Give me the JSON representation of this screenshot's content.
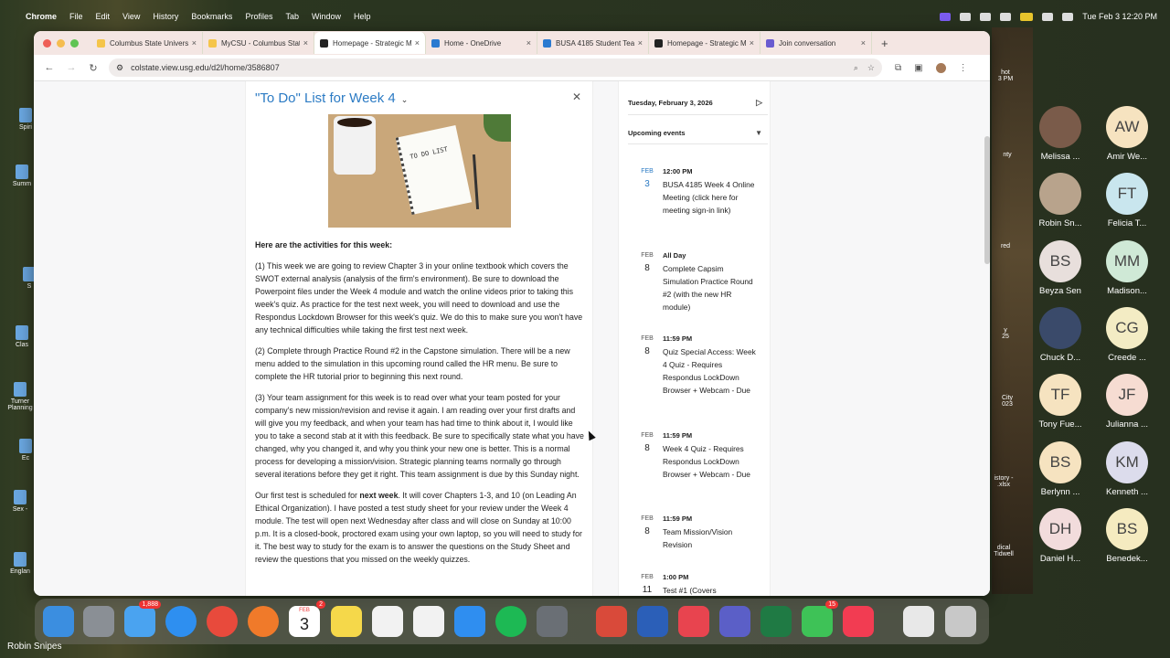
{
  "menubar": {
    "apple": "",
    "app": "Chrome",
    "items": [
      "File",
      "Edit",
      "View",
      "History",
      "Bookmarks",
      "Profiles",
      "Tab",
      "Window",
      "Help"
    ],
    "clock": "Tue Feb 3  12:20 PM"
  },
  "desktop": {
    "left_labels": [
      "Spiri",
      "Summ",
      "S",
      "Clas",
      "Turner\nPlanning",
      "Ec",
      "Sex -",
      "Englan"
    ],
    "right_labels": [
      "hot\n3 PM",
      "nty",
      "red",
      "y\n25",
      "City\n023",
      "istory -\n.xlsx",
      "dical\nTidwell"
    ]
  },
  "browser": {
    "tabs": [
      {
        "label": "Columbus State Universit",
        "color": "#f5c54a"
      },
      {
        "label": "MyCSU - Columbus State",
        "color": "#f5c54a"
      },
      {
        "label": "Homepage - Strategic M",
        "color": "#222"
      },
      {
        "label": "Home - OneDrive",
        "color": "#2b7ad0"
      },
      {
        "label": "BUSA 4185 Student Team",
        "color": "#2b7ad0"
      },
      {
        "label": "Homepage - Strategic M",
        "color": "#222"
      },
      {
        "label": "Join conversation",
        "color": "#6a5bd0"
      }
    ],
    "new_tab": "+",
    "url": "colstate.view.usg.edu/d2l/home/3586807"
  },
  "todo": {
    "title": "\"To Do\" List for Week 4",
    "photo_text": "TO DO LIST",
    "heading": "Here are the activities for this week:",
    "p1": "(1) This week we are going to review Chapter 3 in your online textbook which covers the SWOT external analysis (analysis of the firm's environment).  Be sure to download the Powerpoint files under the Week 4 module and watch the online videos prior to taking this week's quiz. As practice for the test next week, you will need to download and use the Respondus Lockdown Browser for this week's quiz. We do this to make sure you won't have any technical difficulties while taking the first test next week.",
    "p2": "(2) Complete through Practice Round #2 in the Capstone simulation. There will be a new menu added to the simulation in this upcoming round called the HR menu. Be sure to complete the HR tutorial prior to beginning this next round.",
    "p3": "(3) Your team assignment for this week is to read over what your team posted for your company's new mission/revision and revise it again. I am reading over your first drafts and will give you my feedback, and when your team has had time to think about it, I would like you to take a second stab at it with this feedback. Be sure to specifically state what you have changed, why you changed it, and why you think your new one is better. This is a normal process for developing a mission/vision. Strategic planning teams normally go through several iterations before they get it right. This team assignment is due by this Sunday night.",
    "p4_a": "Our first test is scheduled for ",
    "p4_b": "next week",
    "p4_c": ". It will cover Chapters 1-3, and 10 (on Leading An Ethical Organization).  I have posted a test study sheet for your review under the Week 4 module. The test will open next Wednesday after class and will close on Sunday at 10:00 p.m. It is a closed-book, proctored exam using your own laptop, so you will need to study for it. The best way to study for the exam is to answer the questions on the Study Sheet and review the questions that you missed on the weekly quizzes."
  },
  "calendar": {
    "date": "Tuesday, February 3, 2026",
    "upcoming": "Upcoming events",
    "events": [
      {
        "mon": "FEB",
        "day": "3",
        "time": "12:00 PM",
        "title": "BUSA 4185 Week 4 Online Meeting (click here for meeting sign-in link)"
      },
      {
        "mon": "FEB",
        "day": "8",
        "time": "All Day",
        "title": "Complete Capsim Simulation Practice Round #2 (with the new HR module)"
      },
      {
        "mon": "FEB",
        "day": "8",
        "time": "11:59 PM",
        "title": "Quiz Special Access: Week 4 Quiz - Requires Respondus LockDown Browser + Webcam - Due"
      },
      {
        "mon": "FEB",
        "day": "8",
        "time": "11:59 PM",
        "title": "Week 4 Quiz - Requires Respondus LockDown Browser + Webcam - Due"
      },
      {
        "mon": "FEB",
        "day": "8",
        "time": "11:59 PM",
        "title": "Team Mission/Vision Revision"
      },
      {
        "mon": "FEB",
        "day": "11",
        "time": "1:00 PM",
        "title": "Test #1 (Covers"
      }
    ]
  },
  "participants": [
    {
      "name": "Melissa ...",
      "initials": "",
      "bg": "#7a5b4a"
    },
    {
      "name": "Amir We...",
      "initials": "AW",
      "bg": "#f6e3c0"
    },
    {
      "name": "Robin Sn...",
      "initials": "",
      "bg": "#b8a38c"
    },
    {
      "name": "Felicia T...",
      "initials": "FT",
      "bg": "#c9e6ee"
    },
    {
      "name": "Beyza Sen",
      "initials": "BS",
      "bg": "#e8dfdc"
    },
    {
      "name": "Madison...",
      "initials": "MM",
      "bg": "#cfe9d6"
    },
    {
      "name": "Chuck D...",
      "initials": "",
      "bg": "#3a4a6a"
    },
    {
      "name": "Creede ...",
      "initials": "CG",
      "bg": "#f3ecc4"
    },
    {
      "name": "Tony Fue...",
      "initials": "TF",
      "bg": "#f6e3c0"
    },
    {
      "name": "Julianna ...",
      "initials": "JF",
      "bg": "#f6dcd2"
    },
    {
      "name": "Berlynn ...",
      "initials": "BS",
      "bg": "#f6e3c0"
    },
    {
      "name": "Kenneth ...",
      "initials": "KM",
      "bg": "#dcdcec"
    },
    {
      "name": "Daniel H...",
      "initials": "DH",
      "bg": "#f2dcdc"
    },
    {
      "name": "Benedek...",
      "initials": "BS",
      "bg": "#f5ebc0"
    }
  ],
  "dock": {
    "mail_badge": "1,888",
    "calendar_badge": "2",
    "calendar_month": "FEB",
    "calendar_day": "3",
    "messages_badge": "15"
  },
  "presenter": "Robin Snipes"
}
